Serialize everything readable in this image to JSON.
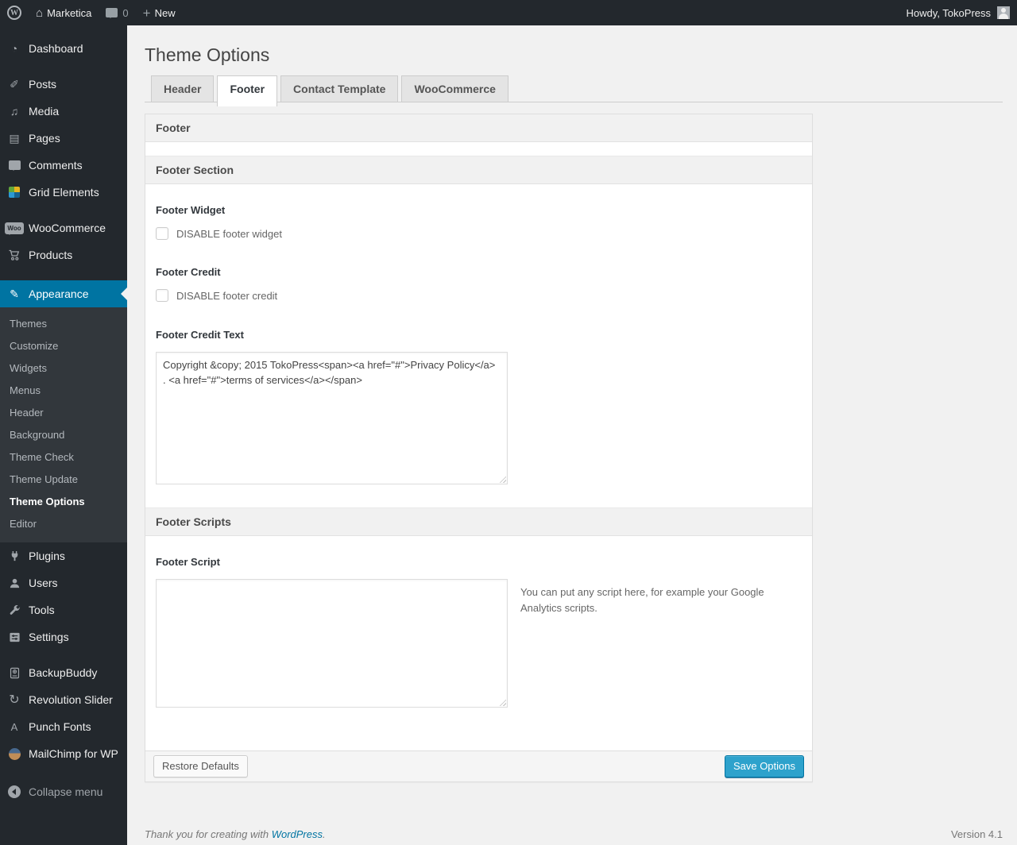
{
  "admin_bar": {
    "site_name": "Marketica",
    "comment_count": "0",
    "new_label": "New",
    "howdy": "Howdy, TokoPress"
  },
  "icons": {
    "wordpress_logo": "W",
    "home": "⌂",
    "new_plus": "+",
    "dashboard": "◔",
    "posts": "✐",
    "media": "♫",
    "pages": "▤",
    "appearance": "✎",
    "woocommerce_badge": "Woo",
    "revolution_slider": "↻",
    "punch_fonts": "A"
  },
  "sidebar": {
    "menu": [
      {
        "label": "Dashboard"
      },
      {
        "label": "Posts"
      },
      {
        "label": "Media"
      },
      {
        "label": "Pages"
      },
      {
        "label": "Comments"
      },
      {
        "label": "Grid Elements"
      },
      {
        "label": "WooCommerce"
      },
      {
        "label": "Products"
      },
      {
        "label": "Appearance"
      },
      {
        "label": "Plugins"
      },
      {
        "label": "Users"
      },
      {
        "label": "Tools"
      },
      {
        "label": "Settings"
      },
      {
        "label": "BackupBuddy"
      },
      {
        "label": "Revolution Slider"
      },
      {
        "label": "Punch Fonts"
      },
      {
        "label": "MailChimp for WP"
      }
    ],
    "submenu": [
      "Themes",
      "Customize",
      "Widgets",
      "Menus",
      "Header",
      "Background",
      "Theme Check",
      "Theme Update",
      "Theme Options",
      "Editor"
    ],
    "current_submenu": "Theme Options",
    "collapse_label": "Collapse menu"
  },
  "page": {
    "title": "Theme Options",
    "tabs": [
      {
        "label": "Header"
      },
      {
        "label": "Footer"
      },
      {
        "label": "Contact Template"
      },
      {
        "label": "WooCommerce"
      }
    ]
  },
  "panel": {
    "header": "Footer",
    "footer_section_title": "Footer Section",
    "footer_widget_label": "Footer Widget",
    "footer_widget_checkbox_label": "DISABLE footer widget",
    "footer_credit_label": "Footer Credit",
    "footer_credit_checkbox_label": "DISABLE footer credit",
    "footer_credit_text_label": "Footer Credit Text",
    "footer_credit_text_value": "Copyright &copy; 2015 TokoPress<span><a href=\"#\">Privacy Policy</a> . <a href=\"#\">terms of services</a></span>",
    "footer_scripts_title": "Footer Scripts",
    "footer_script_label": "Footer Script",
    "footer_script_value": "",
    "footer_script_help": "You can put any script here, for example your Google Analytics scripts.",
    "restore_button": "Restore Defaults",
    "save_button": "Save Options"
  },
  "page_footer": {
    "thanks_text": "Thank you for creating with",
    "wordpress_link": "WordPress",
    "period": ".",
    "version": "Version 4.1"
  },
  "colors": {
    "admin_dark": "#23282d",
    "submenu_bg": "#32373c",
    "menu_highlight": "#0074a2",
    "accent_blue": "#2ea2cc",
    "link_blue": "#0074a2",
    "body_bg": "#f1f1f1"
  }
}
